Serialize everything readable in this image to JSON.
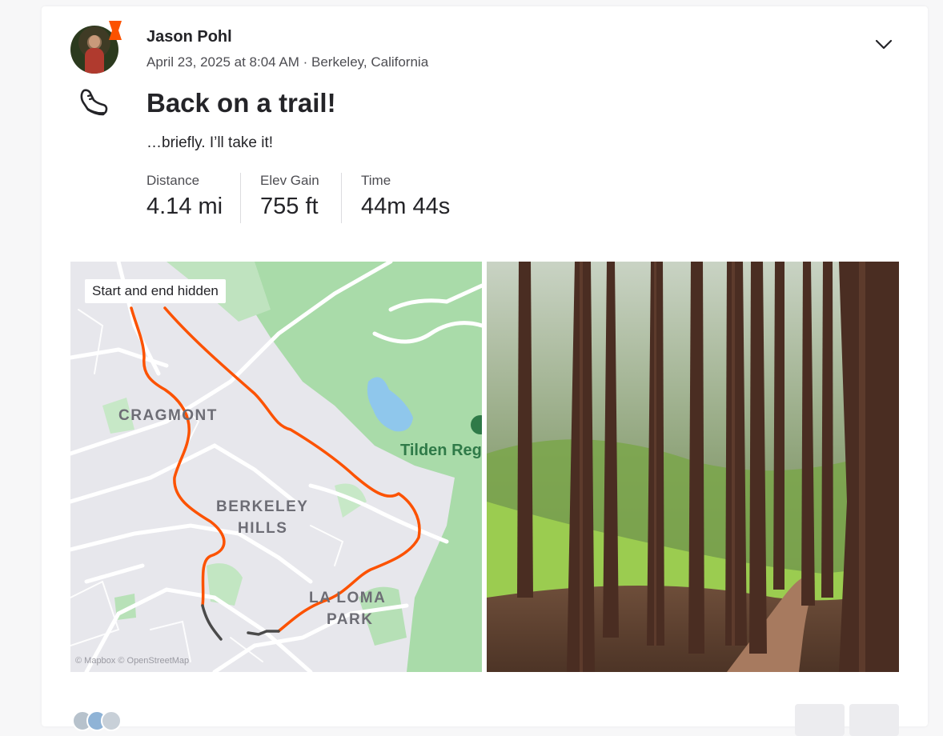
{
  "activity": {
    "athlete_name": "Jason Pohl",
    "date": "April 23, 2025 at 8:04 AM",
    "location": "Berkeley, California",
    "meta_separator": " · ",
    "sport_icon": "run-shoe-icon",
    "title": "Back on a trail!",
    "description": "…briefly. I’ll take it!",
    "stats": [
      {
        "label": "Distance",
        "value": "4.14 mi"
      },
      {
        "label": "Elev Gain",
        "value": "755 ft"
      },
      {
        "label": "Time",
        "value": "44m 44s"
      }
    ]
  },
  "map": {
    "privacy_tag": "Start and end hidden",
    "labels": [
      "CRAGMONT",
      "BERKELEY",
      "HILLS",
      "LA LOMA",
      "PARK"
    ],
    "park_label": "Tilden Reg",
    "attribution": "© Mapbox © OpenStreetMap"
  },
  "colors": {
    "route": "#fc5200",
    "badge": "#fc5200",
    "park": "#a9dba9"
  }
}
